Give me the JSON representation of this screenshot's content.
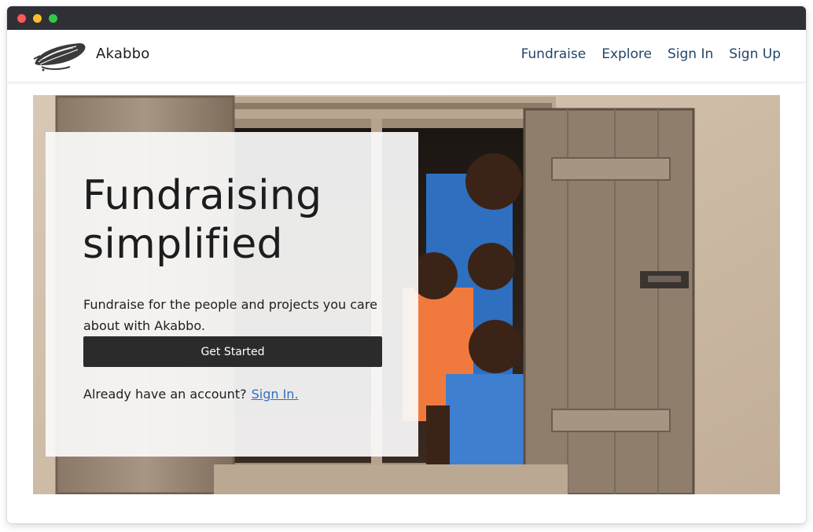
{
  "header": {
    "brand": "Akabbo",
    "nav": [
      {
        "label": "Fundraise"
      },
      {
        "label": "Explore"
      },
      {
        "label": "Sign In"
      },
      {
        "label": "Sign Up"
      }
    ]
  },
  "hero": {
    "title_line1": "Fundraising",
    "title_line2": "simplified",
    "subtitle": "Fundraise for the people and projects you care about with Akabbo.",
    "cta_label": "Get Started",
    "account_prompt": "Already have an account?",
    "signin_link": "Sign In."
  },
  "colors": {
    "titlebar": "#2f3035",
    "nav_link": "#22466a",
    "cta_background": "#2b2b2b",
    "link_blue": "#2f6ec4"
  },
  "icons": {
    "logo": "bird-sketch-icon",
    "window_controls": [
      "close-dot",
      "minimize-dot",
      "maximize-dot"
    ]
  }
}
